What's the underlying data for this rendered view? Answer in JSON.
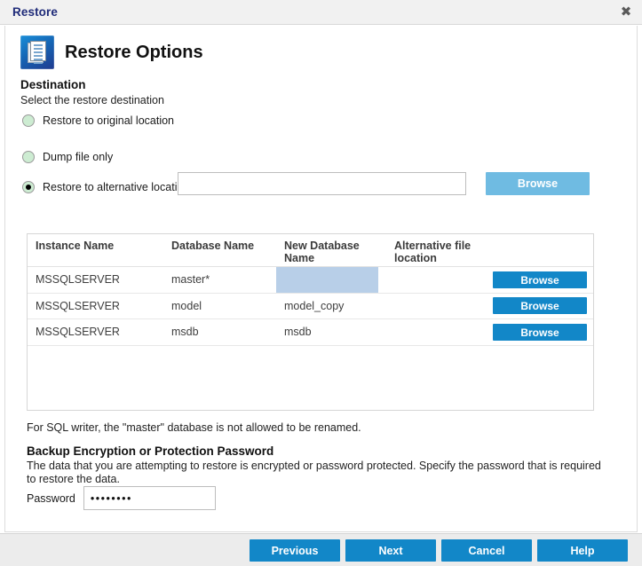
{
  "window": {
    "title": "Restore",
    "close_icon": "close-icon"
  },
  "page": {
    "icon": "document-pages-icon",
    "title": "Restore Options"
  },
  "destination": {
    "heading": "Destination",
    "subheading": "Select the restore destination",
    "options": [
      {
        "label": "Restore to original location",
        "selected": false
      },
      {
        "label": "Dump file only",
        "selected": false
      },
      {
        "label": "Restore to alternative location",
        "selected": true
      }
    ],
    "dump_file": {
      "value": "",
      "placeholder": "",
      "browse_label": "Browse",
      "browse_disabled": true
    }
  },
  "grid": {
    "columns": [
      "Instance Name",
      "Database Name",
      "New Database Name",
      "Alternative file location",
      ""
    ],
    "rows": [
      {
        "instance": "MSSQLSERVER",
        "database": "master*",
        "new_name": "",
        "new_name_editing": true,
        "alt_location": "",
        "browse_label": "Browse"
      },
      {
        "instance": "MSSQLSERVER",
        "database": "model",
        "new_name": "model_copy",
        "new_name_editing": false,
        "alt_location": "",
        "browse_label": "Browse"
      },
      {
        "instance": "MSSQLSERVER",
        "database": "msdb",
        "new_name": "msdb",
        "new_name_editing": false,
        "alt_location": "",
        "browse_label": "Browse"
      }
    ]
  },
  "note": "For SQL writer, the \"master\" database is not allowed to be renamed.",
  "password_section": {
    "heading": "Backup Encryption or Protection Password",
    "description": "The data that you are attempting to restore is encrypted or password protected. Specify the password that is required to restore the data.",
    "label": "Password",
    "value": "••••••••"
  },
  "footer": {
    "previous": "Previous",
    "next": "Next",
    "cancel": "Cancel",
    "help": "Help"
  },
  "colors": {
    "accent_blue": "#1287c8",
    "accent_blue_disabled": "#6fbbe2",
    "title_text": "#1f2b79",
    "radio_fill": "#cdecd2",
    "cell_edit_bg": "#b8cfe8",
    "footer_bg": "#ececec"
  }
}
